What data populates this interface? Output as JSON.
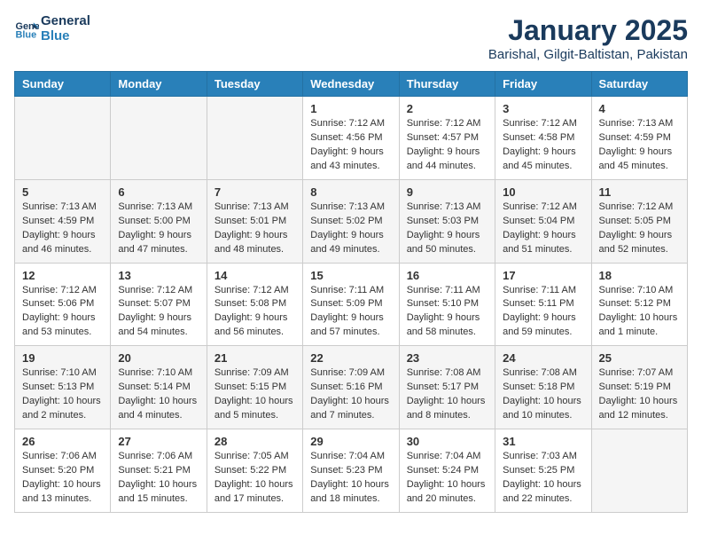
{
  "header": {
    "logo_line1": "General",
    "logo_line2": "Blue",
    "month": "January 2025",
    "location": "Barishal, Gilgit-Baltistan, Pakistan"
  },
  "weekdays": [
    "Sunday",
    "Monday",
    "Tuesday",
    "Wednesday",
    "Thursday",
    "Friday",
    "Saturday"
  ],
  "weeks": [
    [
      {
        "day": "",
        "info": ""
      },
      {
        "day": "",
        "info": ""
      },
      {
        "day": "",
        "info": ""
      },
      {
        "day": "1",
        "info": "Sunrise: 7:12 AM\nSunset: 4:56 PM\nDaylight: 9 hours and 43 minutes."
      },
      {
        "day": "2",
        "info": "Sunrise: 7:12 AM\nSunset: 4:57 PM\nDaylight: 9 hours and 44 minutes."
      },
      {
        "day": "3",
        "info": "Sunrise: 7:12 AM\nSunset: 4:58 PM\nDaylight: 9 hours and 45 minutes."
      },
      {
        "day": "4",
        "info": "Sunrise: 7:13 AM\nSunset: 4:59 PM\nDaylight: 9 hours and 45 minutes."
      }
    ],
    [
      {
        "day": "5",
        "info": "Sunrise: 7:13 AM\nSunset: 4:59 PM\nDaylight: 9 hours and 46 minutes."
      },
      {
        "day": "6",
        "info": "Sunrise: 7:13 AM\nSunset: 5:00 PM\nDaylight: 9 hours and 47 minutes."
      },
      {
        "day": "7",
        "info": "Sunrise: 7:13 AM\nSunset: 5:01 PM\nDaylight: 9 hours and 48 minutes."
      },
      {
        "day": "8",
        "info": "Sunrise: 7:13 AM\nSunset: 5:02 PM\nDaylight: 9 hours and 49 minutes."
      },
      {
        "day": "9",
        "info": "Sunrise: 7:13 AM\nSunset: 5:03 PM\nDaylight: 9 hours and 50 minutes."
      },
      {
        "day": "10",
        "info": "Sunrise: 7:12 AM\nSunset: 5:04 PM\nDaylight: 9 hours and 51 minutes."
      },
      {
        "day": "11",
        "info": "Sunrise: 7:12 AM\nSunset: 5:05 PM\nDaylight: 9 hours and 52 minutes."
      }
    ],
    [
      {
        "day": "12",
        "info": "Sunrise: 7:12 AM\nSunset: 5:06 PM\nDaylight: 9 hours and 53 minutes."
      },
      {
        "day": "13",
        "info": "Sunrise: 7:12 AM\nSunset: 5:07 PM\nDaylight: 9 hours and 54 minutes."
      },
      {
        "day": "14",
        "info": "Sunrise: 7:12 AM\nSunset: 5:08 PM\nDaylight: 9 hours and 56 minutes."
      },
      {
        "day": "15",
        "info": "Sunrise: 7:11 AM\nSunset: 5:09 PM\nDaylight: 9 hours and 57 minutes."
      },
      {
        "day": "16",
        "info": "Sunrise: 7:11 AM\nSunset: 5:10 PM\nDaylight: 9 hours and 58 minutes."
      },
      {
        "day": "17",
        "info": "Sunrise: 7:11 AM\nSunset: 5:11 PM\nDaylight: 9 hours and 59 minutes."
      },
      {
        "day": "18",
        "info": "Sunrise: 7:10 AM\nSunset: 5:12 PM\nDaylight: 10 hours and 1 minute."
      }
    ],
    [
      {
        "day": "19",
        "info": "Sunrise: 7:10 AM\nSunset: 5:13 PM\nDaylight: 10 hours and 2 minutes."
      },
      {
        "day": "20",
        "info": "Sunrise: 7:10 AM\nSunset: 5:14 PM\nDaylight: 10 hours and 4 minutes."
      },
      {
        "day": "21",
        "info": "Sunrise: 7:09 AM\nSunset: 5:15 PM\nDaylight: 10 hours and 5 minutes."
      },
      {
        "day": "22",
        "info": "Sunrise: 7:09 AM\nSunset: 5:16 PM\nDaylight: 10 hours and 7 minutes."
      },
      {
        "day": "23",
        "info": "Sunrise: 7:08 AM\nSunset: 5:17 PM\nDaylight: 10 hours and 8 minutes."
      },
      {
        "day": "24",
        "info": "Sunrise: 7:08 AM\nSunset: 5:18 PM\nDaylight: 10 hours and 10 minutes."
      },
      {
        "day": "25",
        "info": "Sunrise: 7:07 AM\nSunset: 5:19 PM\nDaylight: 10 hours and 12 minutes."
      }
    ],
    [
      {
        "day": "26",
        "info": "Sunrise: 7:06 AM\nSunset: 5:20 PM\nDaylight: 10 hours and 13 minutes."
      },
      {
        "day": "27",
        "info": "Sunrise: 7:06 AM\nSunset: 5:21 PM\nDaylight: 10 hours and 15 minutes."
      },
      {
        "day": "28",
        "info": "Sunrise: 7:05 AM\nSunset: 5:22 PM\nDaylight: 10 hours and 17 minutes."
      },
      {
        "day": "29",
        "info": "Sunrise: 7:04 AM\nSunset: 5:23 PM\nDaylight: 10 hours and 18 minutes."
      },
      {
        "day": "30",
        "info": "Sunrise: 7:04 AM\nSunset: 5:24 PM\nDaylight: 10 hours and 20 minutes."
      },
      {
        "day": "31",
        "info": "Sunrise: 7:03 AM\nSunset: 5:25 PM\nDaylight: 10 hours and 22 minutes."
      },
      {
        "day": "",
        "info": ""
      }
    ]
  ]
}
